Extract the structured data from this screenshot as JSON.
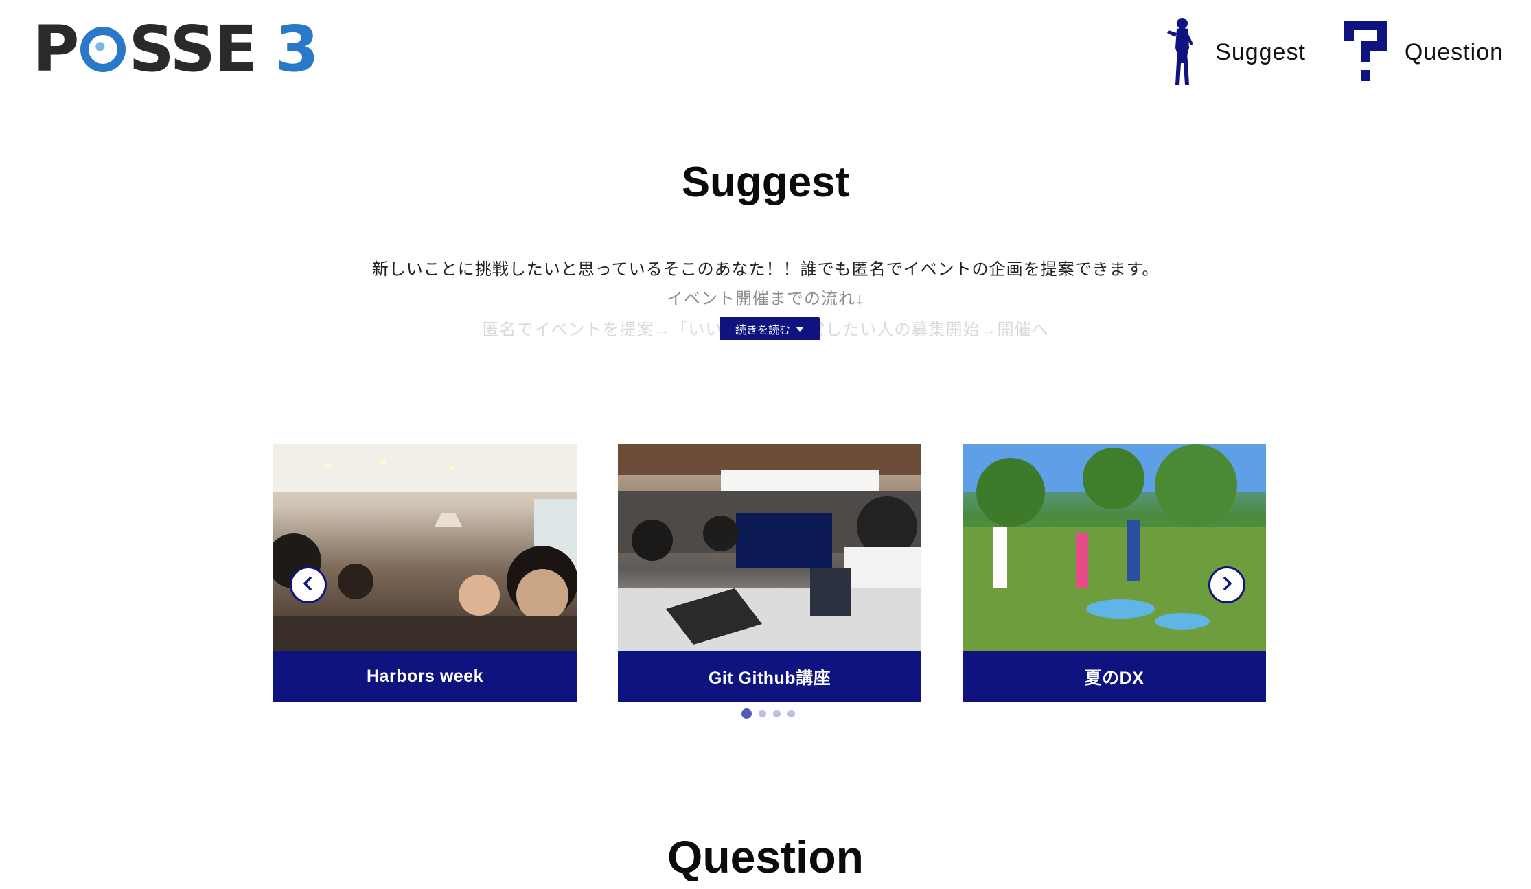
{
  "header": {
    "logo": {
      "word_prefix": "P",
      "word_suffix": "SSE",
      "number": "3"
    },
    "nav": [
      {
        "label": "Suggest",
        "icon": "woman-silhouette-icon"
      },
      {
        "label": "Question",
        "icon": "question-mark-icon"
      }
    ]
  },
  "suggest": {
    "title": "Suggest",
    "description_line1": "新しいことに挑戦したいと思っているそこのあなた！！誰でも匿名でイベントの企画を提案できます。",
    "description_line2": "イベント開催までの流れ↓",
    "description_line3": "匿名でイベントを提案→「いいね！」→運営したい人の募集開始→開催へ",
    "read_more_label": "続きを読む"
  },
  "carousel": {
    "cards": [
      {
        "caption": "Harbors week"
      },
      {
        "caption": "Git Github講座"
      },
      {
        "caption": "夏のDX"
      }
    ],
    "dots": [
      true,
      false,
      false,
      false
    ],
    "prev_icon": "chevron-left-icon",
    "next_icon": "chevron-right-icon"
  },
  "question": {
    "title": "Question"
  },
  "colors": {
    "primary": "#0e137f",
    "logo_blue": "#2a78c8",
    "logo_dark": "#2a2a2a"
  }
}
